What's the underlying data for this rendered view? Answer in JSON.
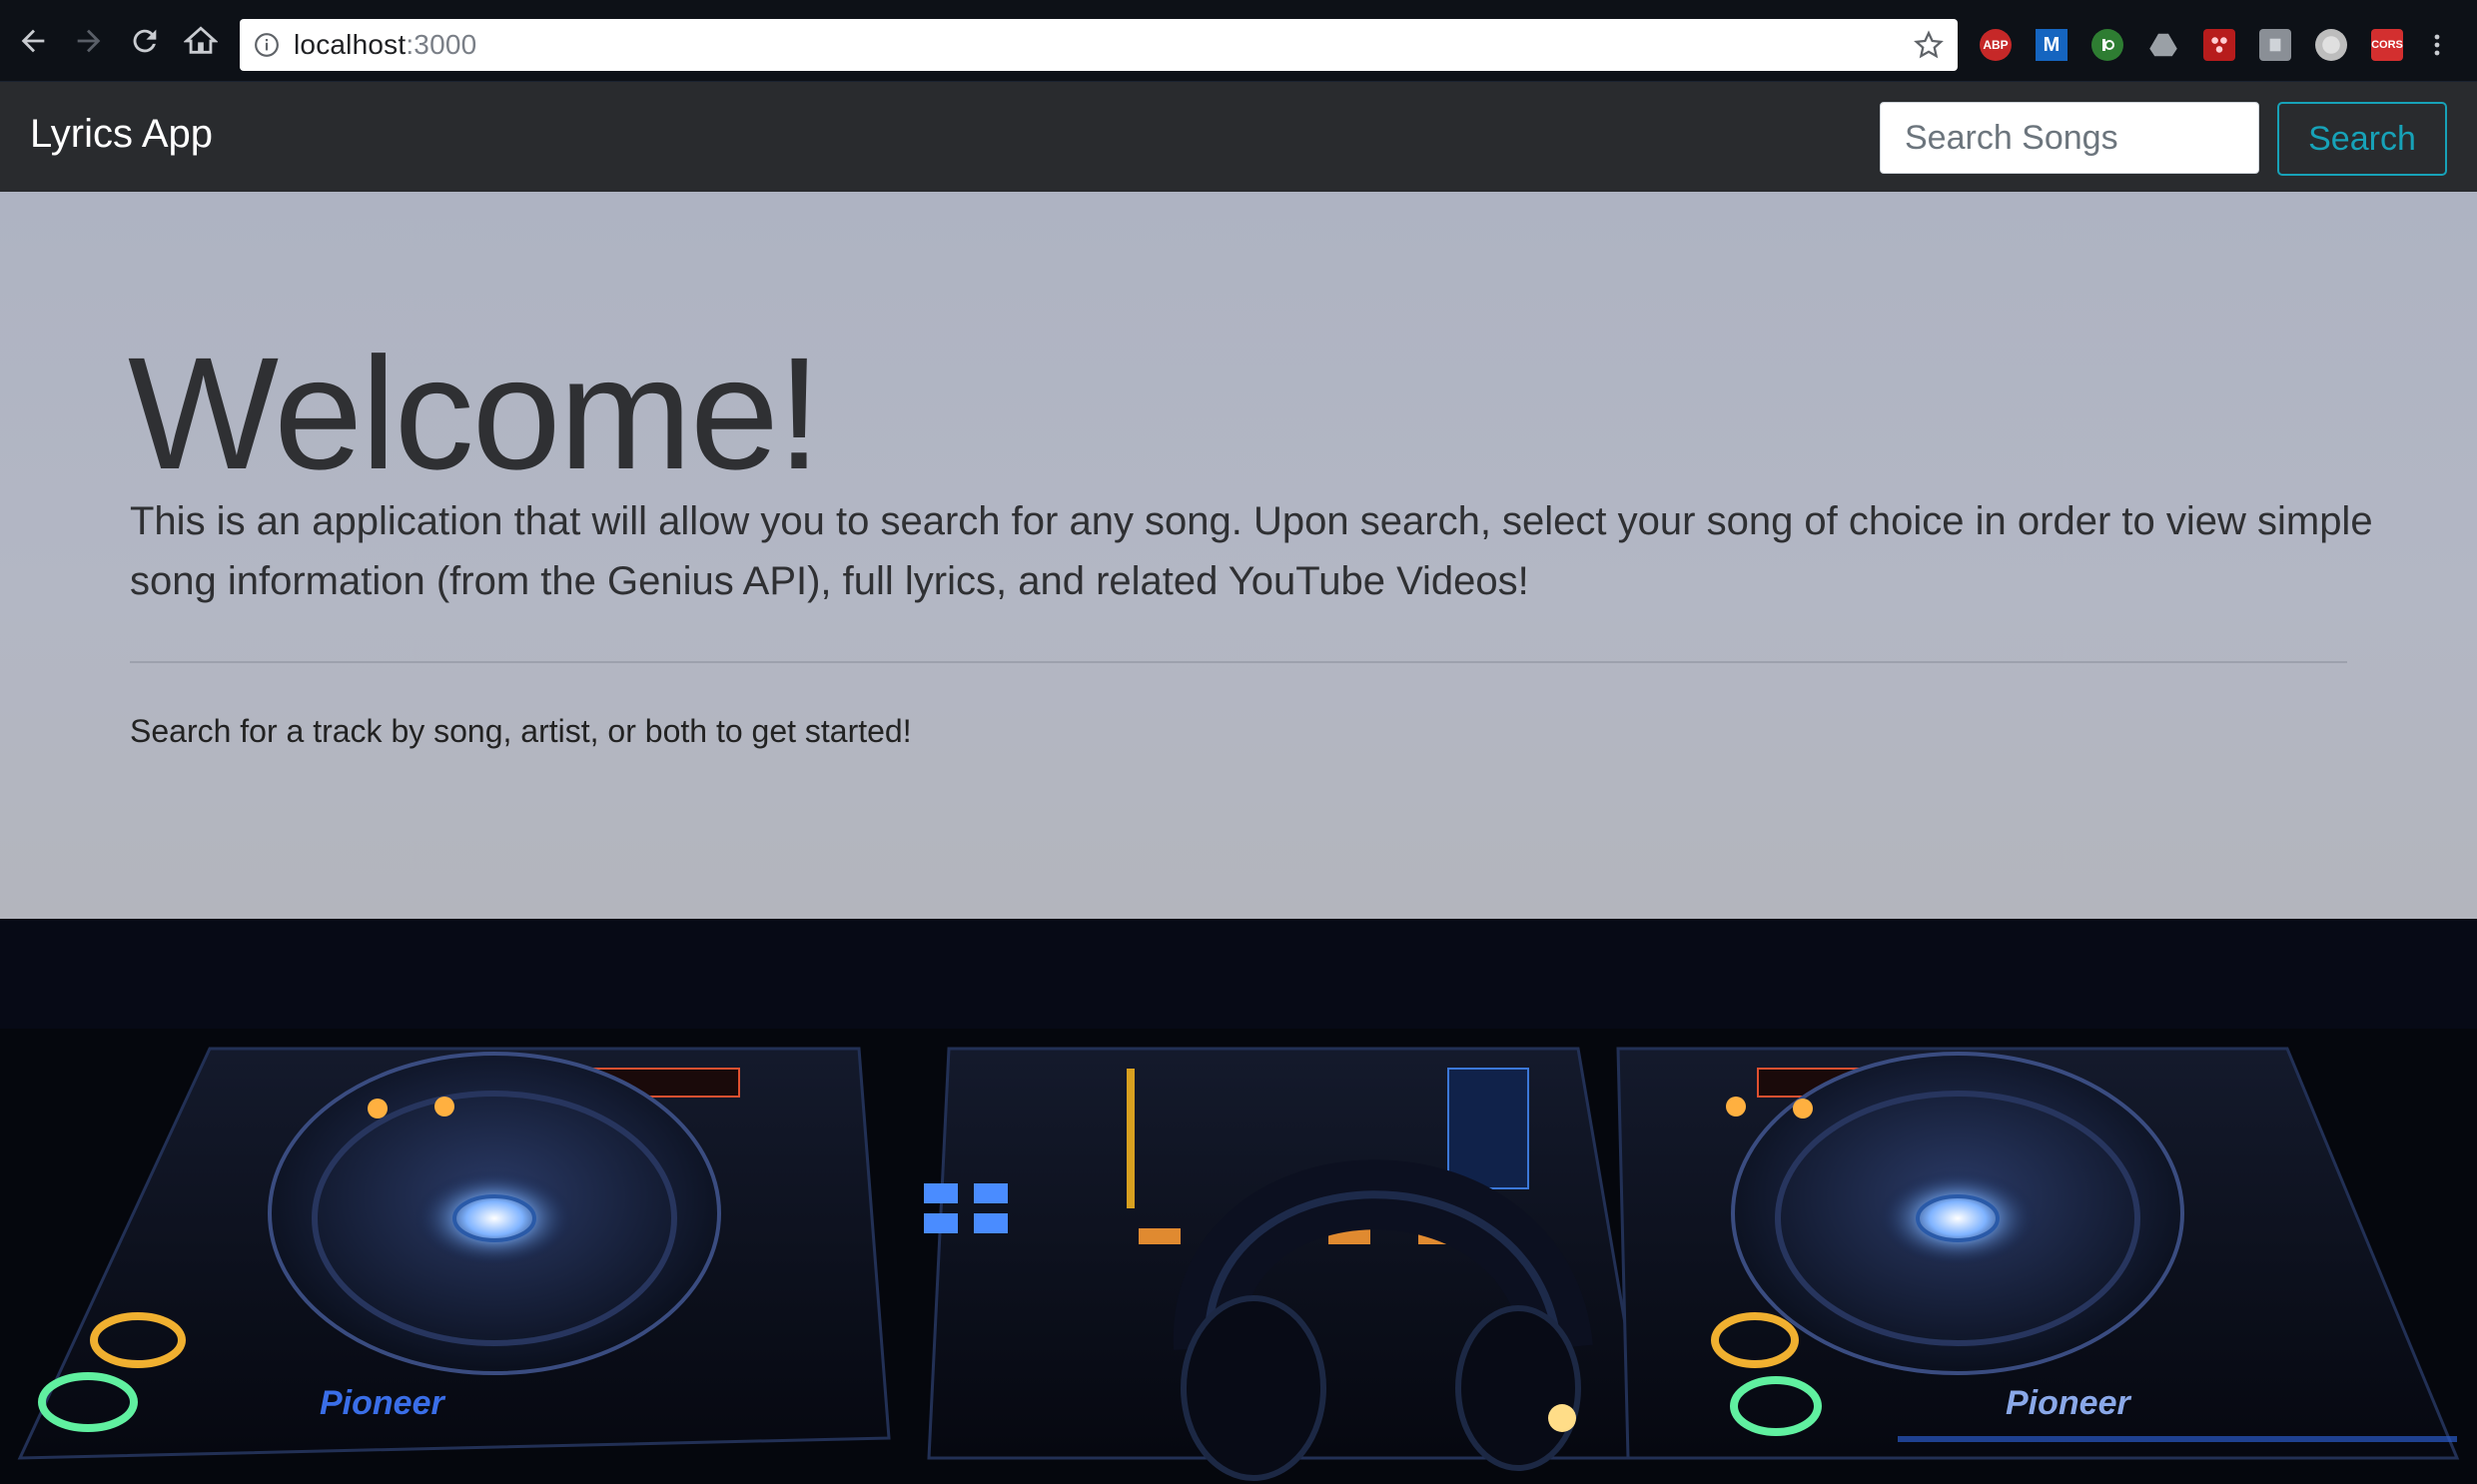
{
  "browser": {
    "url_host": "localhost",
    "url_port": ":3000",
    "extensions": [
      "ABP",
      "M",
      "CORS"
    ]
  },
  "navbar": {
    "brand": "Lyrics App",
    "search_placeholder": "Search Songs",
    "search_button": "Search"
  },
  "jumbotron": {
    "title": "Welcome!",
    "lead": "This is an application that will allow you to search for any song. Upon search, select your song of choice in order to view simple song information (from the Genius API), full lyrics, and related YouTube Videos!",
    "subtext": "Search for a track by song, artist, or both to get started!"
  },
  "background": {
    "brand_label_left": "Pioneer",
    "brand_label_right": "Pioneer"
  },
  "colors": {
    "navbar": "#292b2e",
    "accent": "#17a2b8",
    "jumbotron": "#b0b5c3"
  }
}
